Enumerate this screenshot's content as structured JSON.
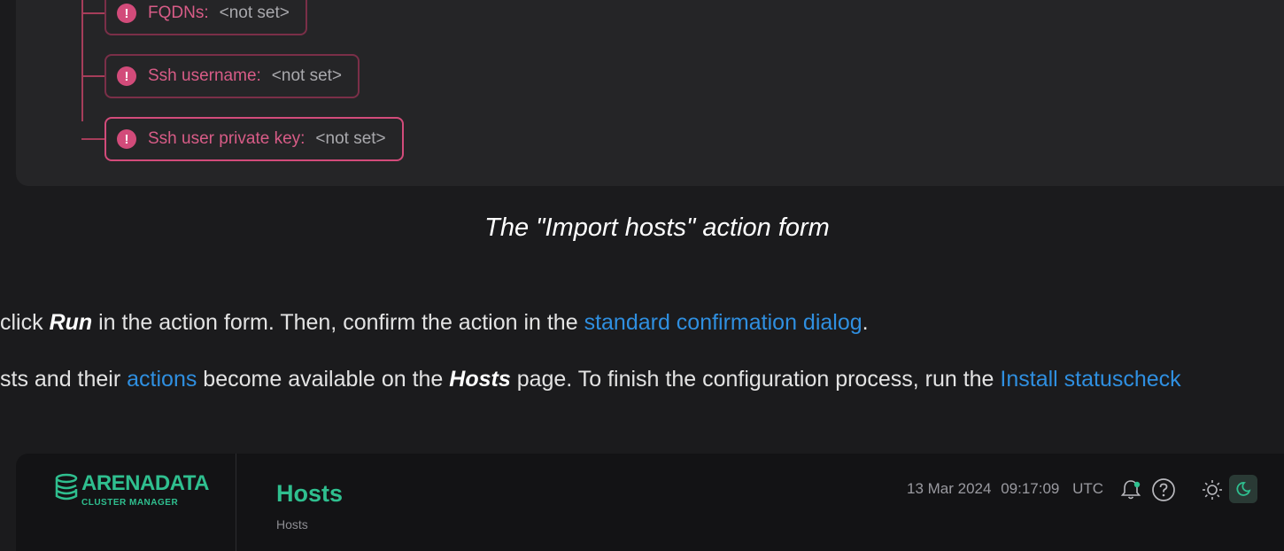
{
  "form": {
    "fields": [
      {
        "label": "FQDNs:",
        "value": "<not set>"
      },
      {
        "label": "Ssh username:",
        "value": "<not set>"
      },
      {
        "label": "Ssh user private key:",
        "value": "<not set>"
      }
    ]
  },
  "caption": "The \"Import hosts\" action form",
  "paragraph1": {
    "pre": " click ",
    "run": "Run",
    "mid": " in the action form. Then, confirm the action in the ",
    "link": "standard confirmation dialog",
    "post": "."
  },
  "paragraph2": {
    "pre": "sts and their ",
    "link1": "actions",
    "mid1": " become available on the ",
    "hosts": "Hosts",
    "mid2": " page. To finish the configuration process, run the ",
    "link2": "Install statuscheck"
  },
  "app": {
    "logo_word": "ARENADATA",
    "logo_sub": "CLUSTER MANAGER",
    "page_title": "Hosts",
    "breadcrumb": "Hosts",
    "date": "13 Mar 2024",
    "time": "09:17:09",
    "timezone": "UTC",
    "icons": [
      "bell-icon",
      "help-icon",
      "sun-icon",
      "moon-icon"
    ]
  },
  "colors": {
    "accent_green": "#2fbf8f",
    "link_blue": "#2f8fe0",
    "error_pink": "#d24b7a"
  }
}
